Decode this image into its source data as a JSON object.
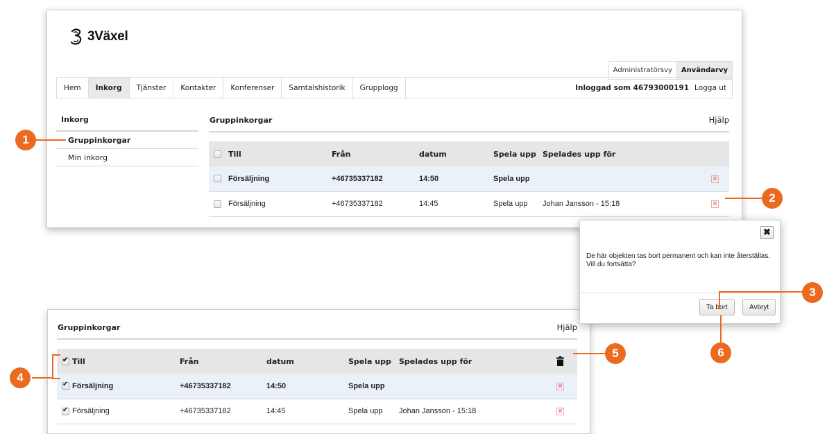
{
  "header": {
    "brand": "3Växel",
    "view_admin": "Administratörsvy",
    "view_user": "Användarvy"
  },
  "nav": {
    "items": [
      "Hem",
      "Inkorg",
      "Tjänster",
      "Kontakter",
      "Konferenser",
      "Samtalshistorik",
      "Grupplogg"
    ],
    "active": "Inkorg",
    "logged_in": "Inloggad som 46793000191",
    "logout": "Logga ut"
  },
  "sidebar": {
    "title": "Inkorg",
    "items": [
      "Gruppinkorgar",
      "Min inkorg"
    ]
  },
  "content": {
    "title": "Gruppinkorgar",
    "help": "Hjälp",
    "columns": [
      "Till",
      "Från",
      "datum",
      "Spela upp",
      "Spelades upp för"
    ],
    "rows": [
      {
        "till": "Försäljning",
        "fran": "+46735337182",
        "datum": "14:50",
        "spela": "Spela upp",
        "for": ""
      },
      {
        "till": "Försäljning",
        "fran": "+46735337182",
        "datum": "14:45",
        "spela": "Spela upp",
        "for": "Johan Jansson - 15:18"
      }
    ]
  },
  "dialog": {
    "close": "✖",
    "message": "De här objekten tas bort permanent och kan inte återställas. Vill du fortsätta?",
    "confirm": "Ta bort",
    "cancel": "Avbryt"
  },
  "callouts": [
    "1",
    "2",
    "3",
    "4",
    "5",
    "6"
  ],
  "colors": {
    "callout": "#ea6b1f",
    "highlight_row": "#eaf1f8",
    "delete_icon": "#e05a5a"
  }
}
